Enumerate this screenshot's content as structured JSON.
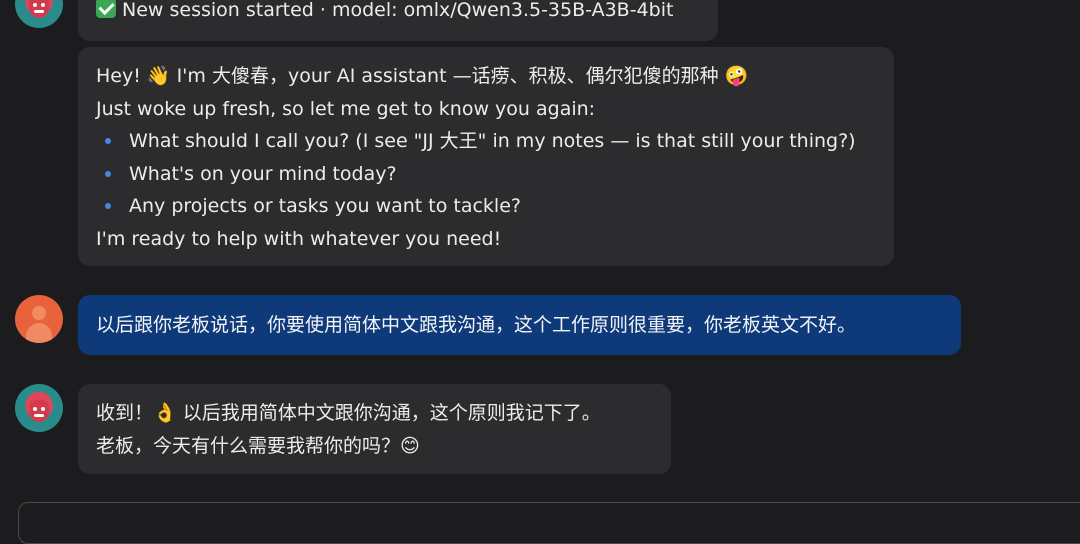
{
  "messages": [
    {
      "role": "assistant",
      "lines": [
        "New session started · model: omlx/Qwen3.5-35B-A3B-4bit"
      ]
    },
    {
      "role": "assistant",
      "intro": [
        "Hey! 👋 I'm 大傻春，your AI assistant —话痨、积极、偶尔犯傻的那种 🤪",
        "Just woke up fresh, so let me get to know you again:"
      ],
      "bullets": [
        "What should I call you? (I see \"JJ 大王\" in my notes — is that still your thing?)",
        "What's on your mind today?",
        "Any projects or tasks you want to tackle?"
      ],
      "outro": "I'm ready to help with whatever you need!"
    },
    {
      "role": "user",
      "text": "以后跟你老板说话，你要使用简体中文跟我沟通，这个工作原则很重要，你老板英文不好。"
    },
    {
      "role": "assistant",
      "lines": [
        "收到！👌 以后我用简体中文跟你沟通，这个原则我记下了。",
        "老板，今天有什么需要我帮你的吗？😊"
      ]
    }
  ],
  "colors": {
    "background": "#1c1c1e",
    "assistant_bubble": "#2c2c2e",
    "user_bubble": "#0f3a7a",
    "bullet": "#4a86e8",
    "check_icon": "#3aa757"
  }
}
